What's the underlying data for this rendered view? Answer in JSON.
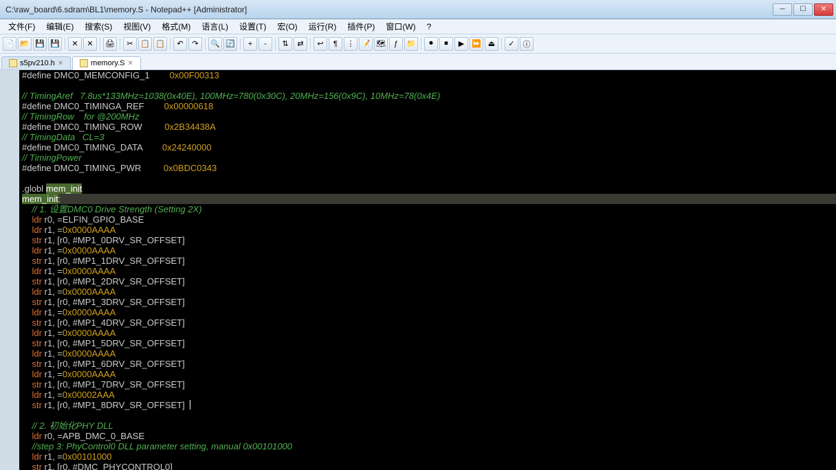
{
  "window": {
    "title": "C:\\raw_board\\6.sdram\\BL1\\memory.S - Notepad++ [Administrator]"
  },
  "menu": {
    "file": "文件(F)",
    "edit": "编辑(E)",
    "search": "搜索(S)",
    "view": "视图(V)",
    "format": "格式(M)",
    "language": "语言(L)",
    "settings": "设置(T)",
    "macro": "宏(O)",
    "run": "运行(R)",
    "plugins": "插件(P)",
    "window": "窗口(W)",
    "help": "?"
  },
  "tabs": {
    "tab1": "s5pv210.h",
    "tab2": "memory.S"
  },
  "code": {
    "l1a": "#define DMC0_MEMCONFIG_1        ",
    "l1b": "0x00F00313",
    "l2": "",
    "l3": "// TimingAref   7.8us*133MHz=1038(0x40E), 100MHz=780(0x30C), 20MHz=156(0x9C), 10MHz=78(0x4E)",
    "l4a": "#define DMC0_TIMINGA_REF        ",
    "l4b": "0x00000618",
    "l5": "// TimingRow    for @200MHz",
    "l6a": "#define DMC0_TIMING_ROW         ",
    "l6b": "0x2B34438A",
    "l7": "// TimingData   CL=3",
    "l8a": "#define DMC0_TIMING_DATA        ",
    "l8b": "0x24240000",
    "l9": "// TimingPower",
    "l10a": "#define DMC0_TIMING_PWR         ",
    "l10b": "0x0BDC0343",
    "l11": "",
    "l12a": ".globl ",
    "l12b": "mem_init",
    "l13a": "mem_init",
    "l13b": ":",
    "l14": "    // 1. 设置DMC0 Drive Strength (Setting 2X)",
    "l15a": "    ",
    "l15b": "ldr",
    "l15c": " r0, =ELFIN_GPIO_BASE",
    "l16a": "    ",
    "l16b": "ldr",
    "l16c": " r1, =",
    "l16d": "0x0000AAAA",
    "l17a": "    ",
    "l17b": "str",
    "l17c": " r1, [r0, #MP1_0DRV_SR_OFFSET]",
    "l18a": "    ",
    "l18b": "ldr",
    "l18c": " r1, =",
    "l18d": "0x0000AAAA",
    "l19a": "    ",
    "l19b": "str",
    "l19c": " r1, [r0, #MP1_1DRV_SR_OFFSET]",
    "l20a": "    ",
    "l20b": "ldr",
    "l20c": " r1, =",
    "l20d": "0x0000AAAA",
    "l21a": "    ",
    "l21b": "str",
    "l21c": " r1, [r0, #MP1_2DRV_SR_OFFSET]",
    "l22a": "    ",
    "l22b": "ldr",
    "l22c": " r1, =",
    "l22d": "0x0000AAAA",
    "l23a": "    ",
    "l23b": "str",
    "l23c": " r1, [r0, #MP1_3DRV_SR_OFFSET]",
    "l24a": "    ",
    "l24b": "ldr",
    "l24c": " r1, =",
    "l24d": "0x0000AAAA",
    "l25a": "    ",
    "l25b": "str",
    "l25c": " r1, [r0, #MP1_4DRV_SR_OFFSET]",
    "l26a": "    ",
    "l26b": "ldr",
    "l26c": " r1, =",
    "l26d": "0x0000AAAA",
    "l27a": "    ",
    "l27b": "str",
    "l27c": " r1, [r0, #MP1_5DRV_SR_OFFSET]",
    "l28a": "    ",
    "l28b": "ldr",
    "l28c": " r1, =",
    "l28d": "0x0000AAAA",
    "l29a": "    ",
    "l29b": "str",
    "l29c": " r1, [r0, #MP1_6DRV_SR_OFFSET]",
    "l30a": "    ",
    "l30b": "ldr",
    "l30c": " r1, =",
    "l30d": "0x0000AAAA",
    "l31a": "    ",
    "l31b": "str",
    "l31c": " r1, [r0, #MP1_7DRV_SR_OFFSET]",
    "l32a": "    ",
    "l32b": "ldr",
    "l32c": " r1, =",
    "l32d": "0x00002AAA",
    "l33a": "    ",
    "l33b": "str",
    "l33c": " r1, [r0, #MP1_8DRV_SR_OFFSET]",
    "l34": "",
    "l35": "    // 2. 初始化PHY DLL",
    "l36a": "    ",
    "l36b": "ldr",
    "l36c": " r0, =APB_DMC_0_BASE",
    "l37": "    //step 3: PhyControl0 DLL parameter setting, manual 0x00101000",
    "l38a": "    ",
    "l38b": "ldr",
    "l38c": " r1, =",
    "l38d": "0x00101000",
    "l39a": "    ",
    "l39b": "str",
    "l39c": " r1, [r0, #DMC_PHYCONTROL0]"
  },
  "gutter": "\n\n\n\n\n\n\n\n\n\n\n\n\n\n\n\n\n\n\n\n\n\n\n\n\n\n\n\n\n\n\n\n\n\n\n\n\n\n"
}
